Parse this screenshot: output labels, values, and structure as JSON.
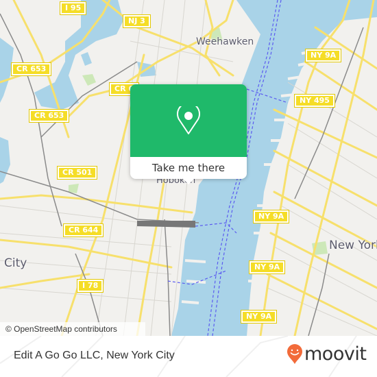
{
  "map": {
    "colors": {
      "land": "#f2f1ee",
      "water": "#a9d3e8",
      "road": "#f7e06c",
      "rail": "#888888",
      "park": "#cde8b8",
      "ferry": "#5a5af0"
    },
    "shields": [
      {
        "id": "i95",
        "label": "I 95"
      },
      {
        "id": "nj3",
        "label": "NJ 3"
      },
      {
        "id": "cr653a",
        "label": "CR 653"
      },
      {
        "id": "cr653b",
        "label": "CR 653"
      },
      {
        "id": "cr6",
        "label": "CR 6"
      },
      {
        "id": "cr501",
        "label": "CR 501"
      },
      {
        "id": "cr644",
        "label": "CR 644"
      },
      {
        "id": "i78",
        "label": "I 78"
      },
      {
        "id": "ny9a1",
        "label": "NY 9A"
      },
      {
        "id": "ny495",
        "label": "NY 495"
      },
      {
        "id": "ny9a2",
        "label": "NY 9A"
      },
      {
        "id": "ny9a3",
        "label": "NY 9A"
      },
      {
        "id": "ny9a4",
        "label": "NY 9A"
      }
    ],
    "places": {
      "weehawken": "Weehawken",
      "hoboken": "Hoboken",
      "new_york": "New York",
      "jersey_city": "City"
    },
    "attribution": "© OpenStreetMap contributors"
  },
  "popup": {
    "icon": "map-pin-icon",
    "button_label": "Take me there",
    "accent": "#1fb96a"
  },
  "footer": {
    "title": "Edit A Go Go LLC, New York City",
    "logo_text": "moovit",
    "logo_color": "#f26b3a"
  }
}
